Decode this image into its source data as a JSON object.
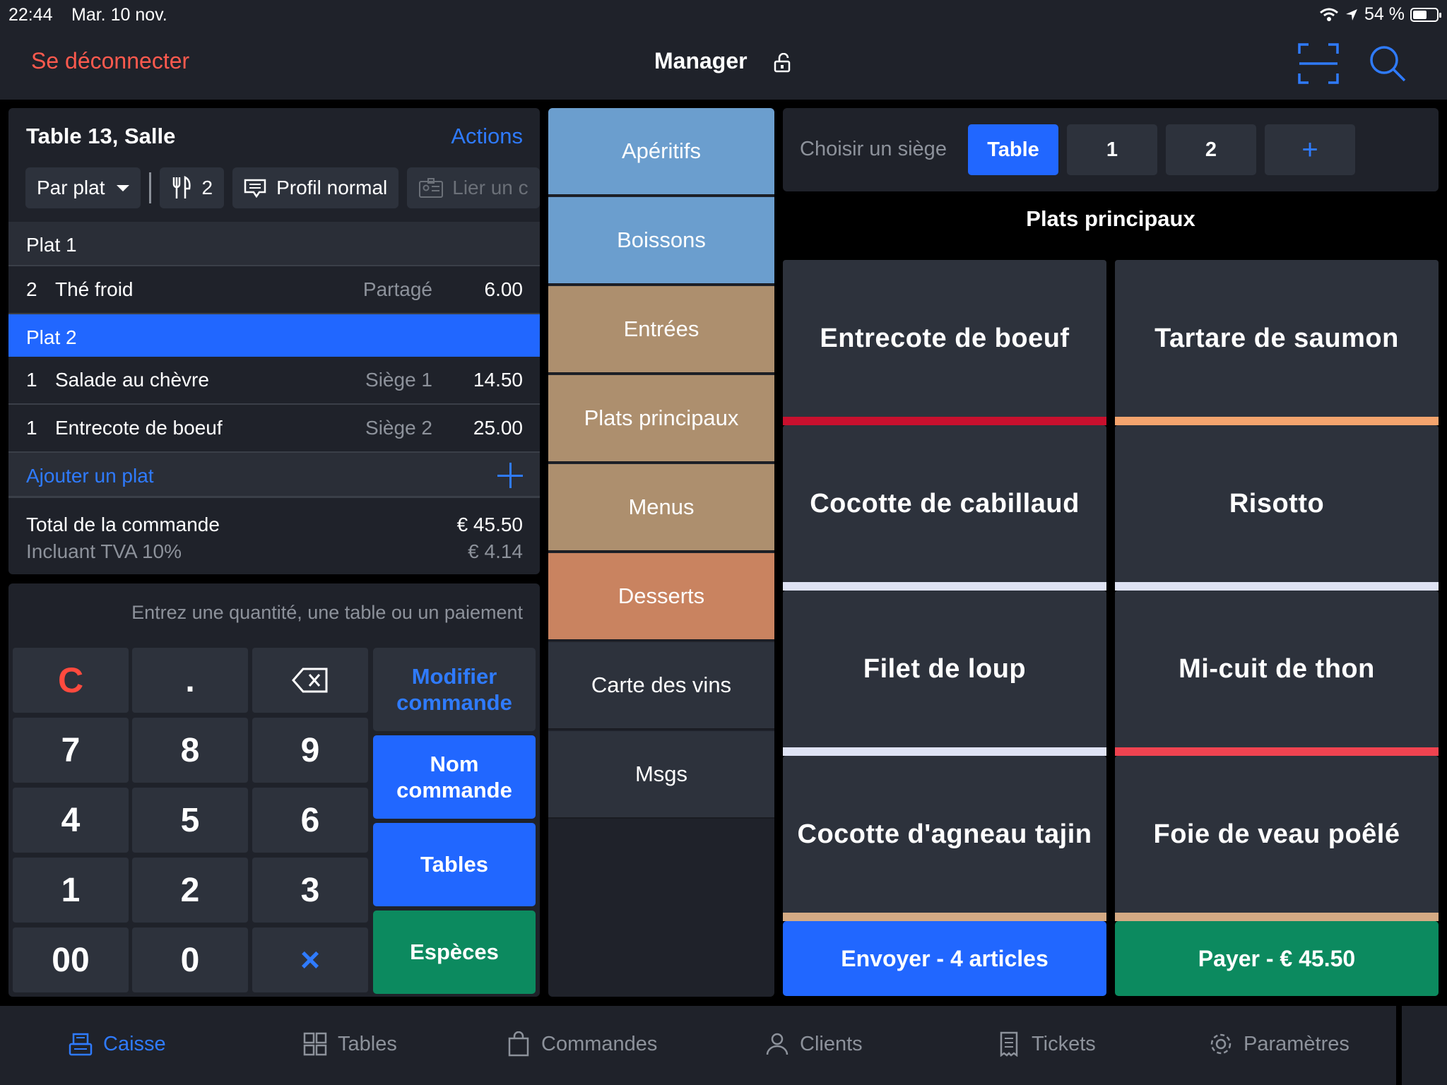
{
  "status": {
    "time": "22:44",
    "date": "Mar. 10 nov.",
    "battery": "54 %",
    "battery_level": 0.54
  },
  "nav": {
    "logout": "Se déconnecter",
    "user": "Manager"
  },
  "order": {
    "title": "Table 13, Salle",
    "actions": "Actions",
    "mode": "Par plat",
    "covers": "2",
    "profile": "Profil normal",
    "link_customer": "Lier un c",
    "sections": [
      {
        "label": "Plat 1",
        "active": false,
        "items": [
          {
            "qty": "2",
            "name": "Thé froid",
            "tag": "Partagé",
            "price": "6.00"
          }
        ]
      },
      {
        "label": "Plat 2",
        "active": true,
        "items": [
          {
            "qty": "1",
            "name": "Salade au chèvre",
            "tag": "Siège 1",
            "price": "14.50"
          },
          {
            "qty": "1",
            "name": "Entrecote de boeuf",
            "tag": "Siège 2",
            "price": "25.00"
          }
        ]
      }
    ],
    "add_item": "Ajouter un plat",
    "total_label": "Total de la commande",
    "total_value": "€ 45.50",
    "vat_label": "Incluant TVA 10%",
    "vat_value": "€ 4.14"
  },
  "keypad": {
    "hint": "Entrez une quantité, une table ou un paiement",
    "keys": [
      "C",
      ".",
      "⌫",
      "7",
      "8",
      "9",
      "4",
      "5",
      "6",
      "1",
      "2",
      "3",
      "00",
      "0",
      "×"
    ],
    "modify_order": "Modifier commande",
    "name_order": "Nom commande",
    "tables": "Tables",
    "cash": "Espèces"
  },
  "categories": [
    {
      "label": "Apéritifs",
      "color": "#6b9ece"
    },
    {
      "label": "Boissons",
      "color": "#6b9ece"
    },
    {
      "label": "Entrées",
      "color": "#ad8f6e"
    },
    {
      "label": "Plats principaux",
      "color": "#ad8f6e"
    },
    {
      "label": "Menus",
      "color": "#ad8f6e"
    },
    {
      "label": "Desserts",
      "color": "#c98360"
    },
    {
      "label": "Carte des vins",
      "color": "#2d323c"
    },
    {
      "label": "Msgs",
      "color": "#2d323c"
    }
  ],
  "seats": {
    "label": "Choisir un siège",
    "table": "Table",
    "seat1": "1",
    "seat2": "2",
    "add": "+"
  },
  "section_title": "Plats principaux",
  "products": [
    {
      "name": "Entrecote de boeuf",
      "color": "#c8102e"
    },
    {
      "name": "Tartare de saumon",
      "color": "#f4a46e"
    },
    {
      "name": "Cocotte de cabillaud",
      "color": "#dfe3f4"
    },
    {
      "name": "Risotto",
      "color": "#dfe3f4"
    },
    {
      "name": "Filet de loup",
      "color": "#dfe3f4"
    },
    {
      "name": "Mi-cuit de thon",
      "color": "#ef4350"
    },
    {
      "name": "Cocotte d'agneau tajin",
      "color": "#d4aa84"
    },
    {
      "name": "Foie de veau poêlé",
      "color": "#d4aa84"
    }
  ],
  "cta": {
    "send": "Envoyer - 4 articles",
    "pay": "Payer - € 45.50"
  },
  "tabs": [
    {
      "label": "Caisse",
      "icon": "cash-register-icon",
      "active": true
    },
    {
      "label": "Tables",
      "icon": "tables-grid-icon",
      "active": false
    },
    {
      "label": "Commandes",
      "icon": "shopping-bag-icon",
      "active": false
    },
    {
      "label": "Clients",
      "icon": "user-icon",
      "active": false
    },
    {
      "label": "Tickets",
      "icon": "receipt-icon",
      "active": false
    },
    {
      "label": "Paramètres",
      "icon": "gear-icon",
      "active": false
    }
  ]
}
